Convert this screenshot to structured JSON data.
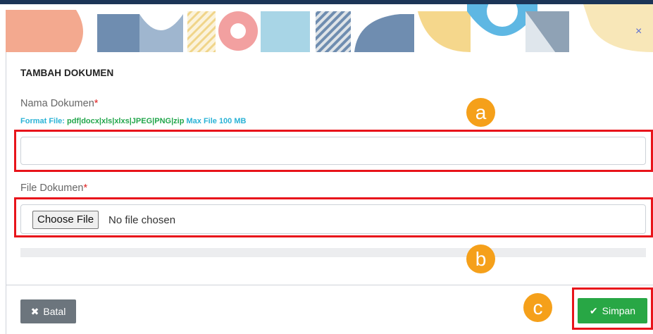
{
  "modal": {
    "title": "TAMBAH DOKUMEN",
    "close_icon": "close-icon",
    "close_glyph": "×"
  },
  "form": {
    "nama": {
      "label": "Nama Dokumen",
      "required_mark": "*",
      "value": ""
    },
    "hint": {
      "prefix": "Format File:",
      "formats": "pdf|docx|xls|xlxs|JPEG|PNG|zip",
      "suffix": "Max File 100 MB"
    },
    "file": {
      "label": "File Dokumen",
      "required_mark": "*",
      "choose_label": "Choose File",
      "status": "No file chosen"
    },
    "upload_progress": 0
  },
  "footer": {
    "cancel": {
      "icon": "x-icon",
      "glyph": "✖",
      "label": "Batal"
    },
    "save": {
      "icon": "check-icon",
      "glyph": "✔",
      "label": "Simpan"
    }
  },
  "annotations": {
    "a": "a",
    "b": "b",
    "c": "c"
  },
  "colors": {
    "topbar": "#1c3557",
    "required": "#e02020",
    "hint_text": "#2bb3d6",
    "hint_formats": "#22a64b",
    "cancel_button": "#6c757d",
    "save_button": "#28a745",
    "highlight_box": "#e8141b",
    "marker": "#f5a01a"
  }
}
